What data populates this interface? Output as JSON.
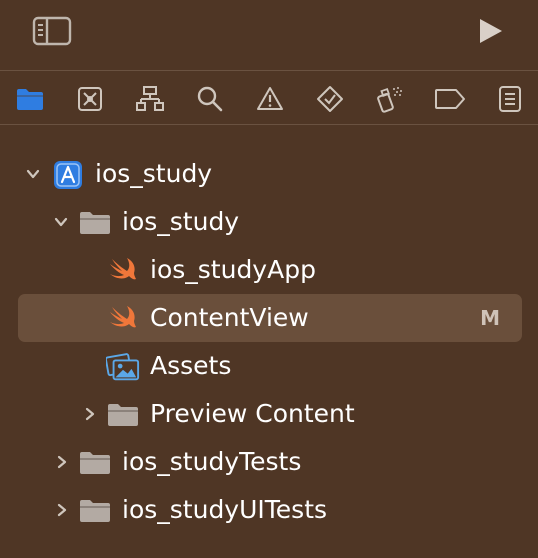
{
  "toolbar": {
    "sidebar_toggle_icon": "sidebar-left-icon",
    "run_icon": "play-icon"
  },
  "navigator_tabs": [
    {
      "icon": "folder-icon",
      "active": true
    },
    {
      "icon": "source-control-icon",
      "active": false
    },
    {
      "icon": "symbol-hierarchy-icon",
      "active": false
    },
    {
      "icon": "search-icon",
      "active": false
    },
    {
      "icon": "warning-icon",
      "active": false
    },
    {
      "icon": "test-diamond-icon",
      "active": false
    },
    {
      "icon": "debug-spray-icon",
      "active": false
    },
    {
      "icon": "breakpoint-icon",
      "active": false
    },
    {
      "icon": "report-list-icon",
      "active": false
    }
  ],
  "tree": [
    {
      "label": "ios_study",
      "icon": "xcode-project-icon",
      "expanded": true,
      "depth": 0
    },
    {
      "label": "ios_study",
      "icon": "folder-icon",
      "expanded": true,
      "depth": 1
    },
    {
      "label": "ios_studyApp",
      "icon": "swift-file-icon",
      "depth": 2
    },
    {
      "label": "ContentView",
      "icon": "swift-file-icon",
      "depth": 2,
      "selected": true,
      "badge": "M"
    },
    {
      "label": "Assets",
      "icon": "asset-catalog-icon",
      "depth": 2
    },
    {
      "label": "Preview Content",
      "icon": "folder-icon",
      "expanded": false,
      "depth": 2
    },
    {
      "label": "ios_studyTests",
      "icon": "folder-icon",
      "expanded": false,
      "depth": 1
    },
    {
      "label": "ios_studyUITests",
      "icon": "folder-icon",
      "expanded": false,
      "depth": 1
    }
  ],
  "colors": {
    "background": "#4f3625",
    "selection": "#6a4f3b",
    "accent": "#2f7de1",
    "swift_orange": "#f0773a",
    "folder_gray": "#b3aaa3"
  }
}
